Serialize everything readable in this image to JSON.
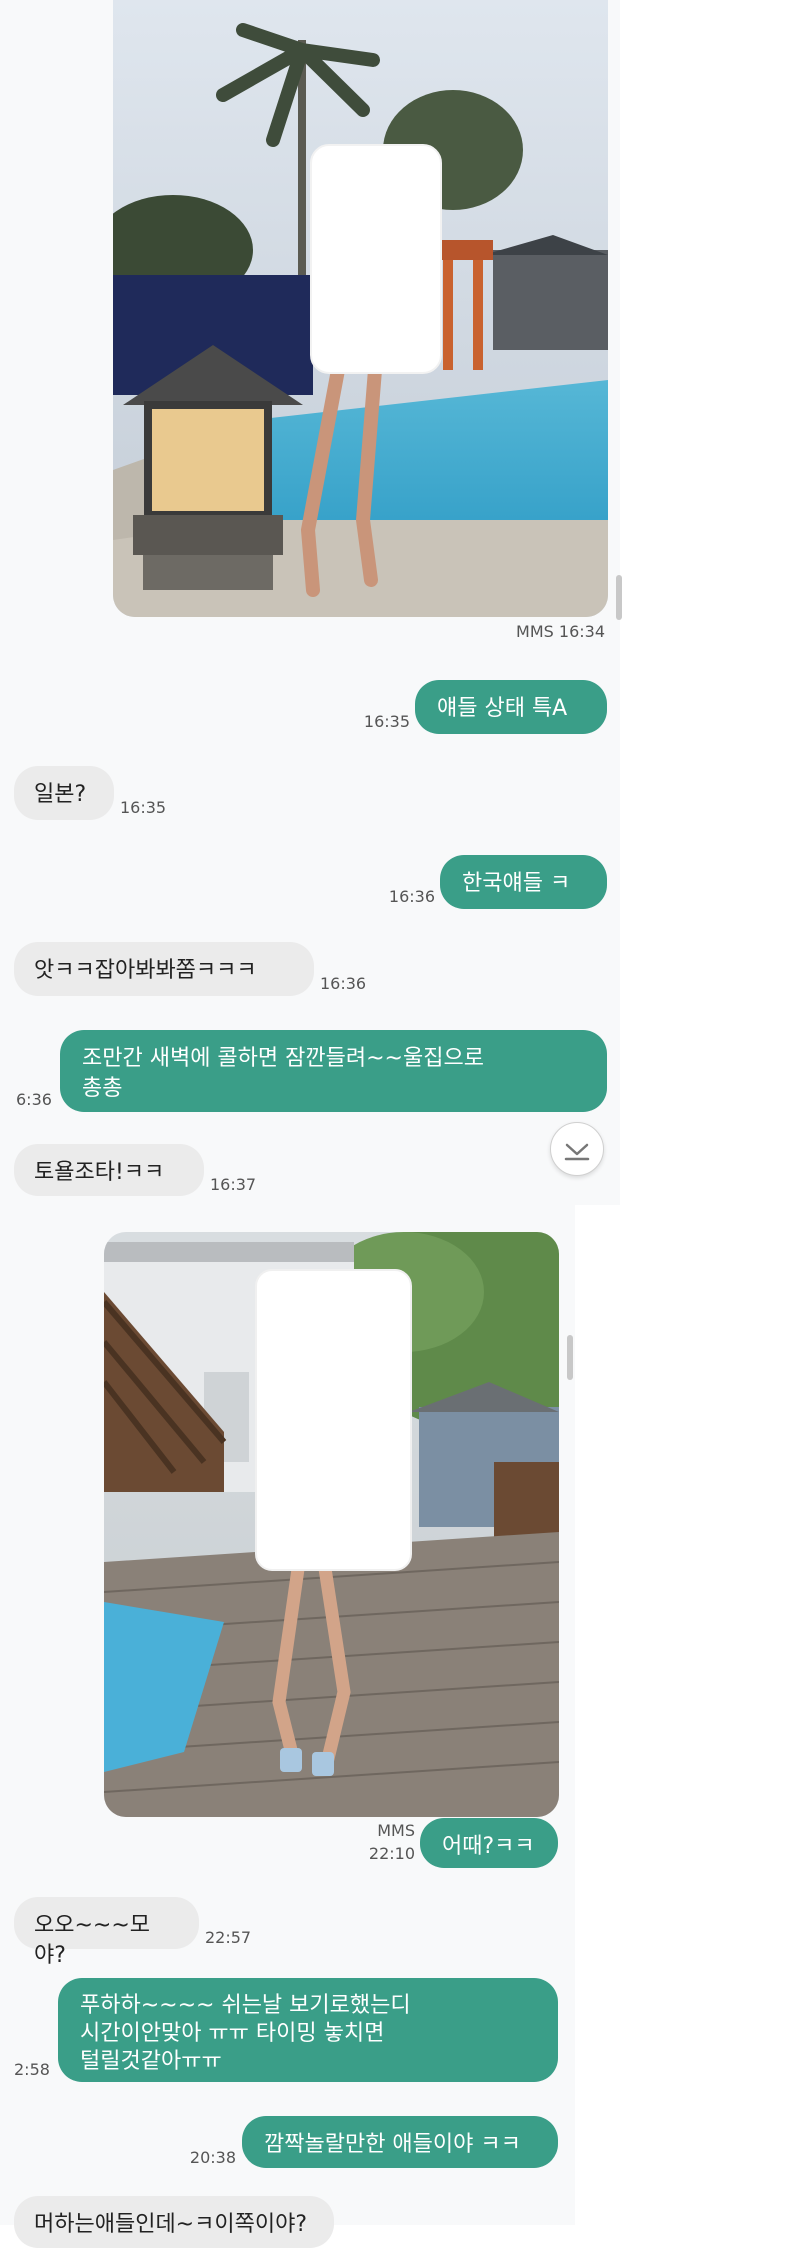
{
  "screen1": {
    "photo_meta": "MMS 16:34",
    "messages": [
      {
        "dir": "out",
        "text": "얘들 상태 특A",
        "time": "16:35"
      },
      {
        "dir": "in",
        "text": "일본?",
        "time": "16:35"
      },
      {
        "dir": "out",
        "text": "한국얘들 ㅋ",
        "time": "16:36"
      },
      {
        "dir": "in",
        "text": "앗ㅋㅋ잡아봐봐쫌ㅋㅋㅋ",
        "time": "16:36"
      },
      {
        "dir": "out",
        "text": "조만간 새벽에 콜하면 잠깐들려~~울집으로\n총총",
        "time": "6:36"
      },
      {
        "dir": "in",
        "text": "토욜조타!ㅋㅋ",
        "time": "16:37"
      }
    ]
  },
  "screen2": {
    "photo_meta_label": "MMS",
    "photo_meta_time": "22:10",
    "messages": [
      {
        "dir": "out",
        "text": "어때?ㅋㅋ",
        "time": ""
      },
      {
        "dir": "in",
        "text": "오오~~~모야?",
        "time": "22:57"
      },
      {
        "dir": "out",
        "text": "푸하하~~~~  쉬는날 보기로했는디\n시간이안맞아 ㅠㅠ 타이밍 놓치면\n털릴것같아ㅠㅠ",
        "time": "2:58"
      },
      {
        "dir": "out",
        "text": "깜짝놀랄만한 애들이야 ㅋㅋ",
        "time": "20:38"
      },
      {
        "dir": "in",
        "text": "머하는애들인데~ㅋ이쪽이야?",
        "time": ""
      }
    ]
  },
  "icons": {
    "scroll_down": "chevron-down-icon"
  },
  "colors": {
    "outgoing": "#3a9e88",
    "incoming": "#ebebeb",
    "background": "#f8f9fa"
  }
}
